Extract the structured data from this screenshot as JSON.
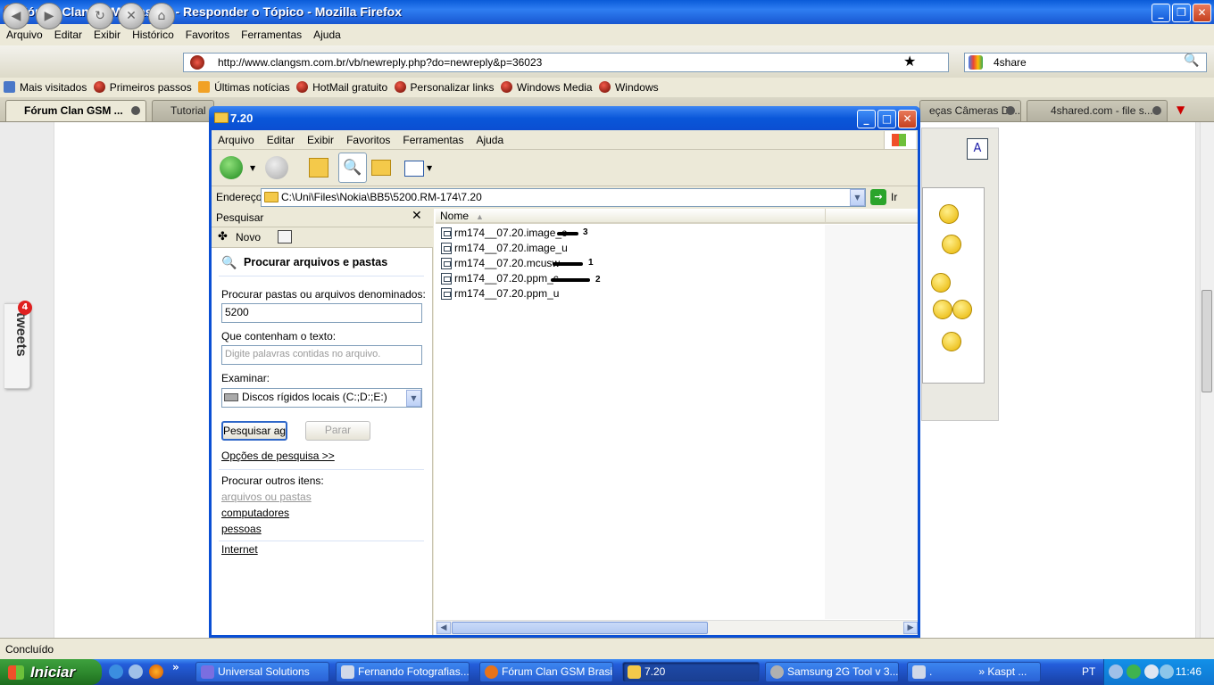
{
  "firefox": {
    "title": "Fórum Clan GSM Brasil ® - Responder o Tópico - Mozilla Firefox",
    "menu": [
      "Arquivo",
      "Editar",
      "Exibir",
      "Histórico",
      "Favoritos",
      "Ferramentas",
      "Ajuda"
    ],
    "url": "http://www.clangsm.com.br/vb/newreply.php?do=newreply&p=36023",
    "search_engine": "4share",
    "bookmarks": [
      "Mais visitados",
      "Primeiros passos",
      "Últimas notícias",
      "HotMail gratuito",
      "Personalizar links",
      "Windows Media",
      "Windows"
    ],
    "tabs": [
      "Fórum Clan GSM ...",
      "Tutorial",
      "eças Câmeras Di...",
      "4shared.com - file s..."
    ],
    "status": "Concluído"
  },
  "tweets": {
    "label": "tweets",
    "count": "4"
  },
  "explorer": {
    "title": "7.20",
    "menu": [
      "Arquivo",
      "Editar",
      "Exibir",
      "Favoritos",
      "Ferramentas",
      "Ajuda"
    ],
    "address_label": "Endereço",
    "address": "C:\\Uni\\Files\\Nokia\\BB5\\5200.RM-174\\7.20",
    "go_label": "Ir",
    "search": {
      "pane_title": "Pesquisar",
      "new_label": "Novo",
      "heading": "Procurar arquivos e pastas",
      "name_label": "Procurar pastas ou arquivos denominados:",
      "name_value": "5200",
      "text_label": "Que contenham o texto:",
      "text_placeholder": "Digite palavras contidas no arquivo.",
      "look_in_label": "Examinar:",
      "look_in_value": "Discos rígidos locais (C:;D:;E:)",
      "search_button": "Pesquisar agora",
      "stop_button": "Parar",
      "options_link": "Opções de pesquisa >>",
      "other_label": "Procurar outros itens:",
      "other_items": [
        "arquivos ou pastas",
        "computadores",
        "pessoas"
      ],
      "internet_link": "Internet"
    },
    "column_name": "Nome",
    "files": [
      {
        "name": "rm174__07.20.image_c",
        "mark": "3"
      },
      {
        "name": "rm174__07.20.image_u",
        "mark": ""
      },
      {
        "name": "rm174__07.20.mcusw",
        "mark": "1"
      },
      {
        "name": "rm174__07.20.ppm_c",
        "mark": "2"
      },
      {
        "name": "rm174__07.20.ppm_u",
        "mark": ""
      }
    ]
  },
  "taskbar": {
    "start": "Iniciar",
    "tasks": [
      "Universal Solutions",
      "Fernando Fotografias...",
      "Fórum Clan GSM Brasi...",
      "7.20",
      "Samsung 2G Tool v 3....",
      ".",
      "» Kaspt ..."
    ],
    "lang": "PT",
    "clock": "11:46"
  },
  "colors": {
    "xp_blue": "#0a4fd4",
    "xp_green": "#3ea13e",
    "beige": "#ece9d8"
  }
}
